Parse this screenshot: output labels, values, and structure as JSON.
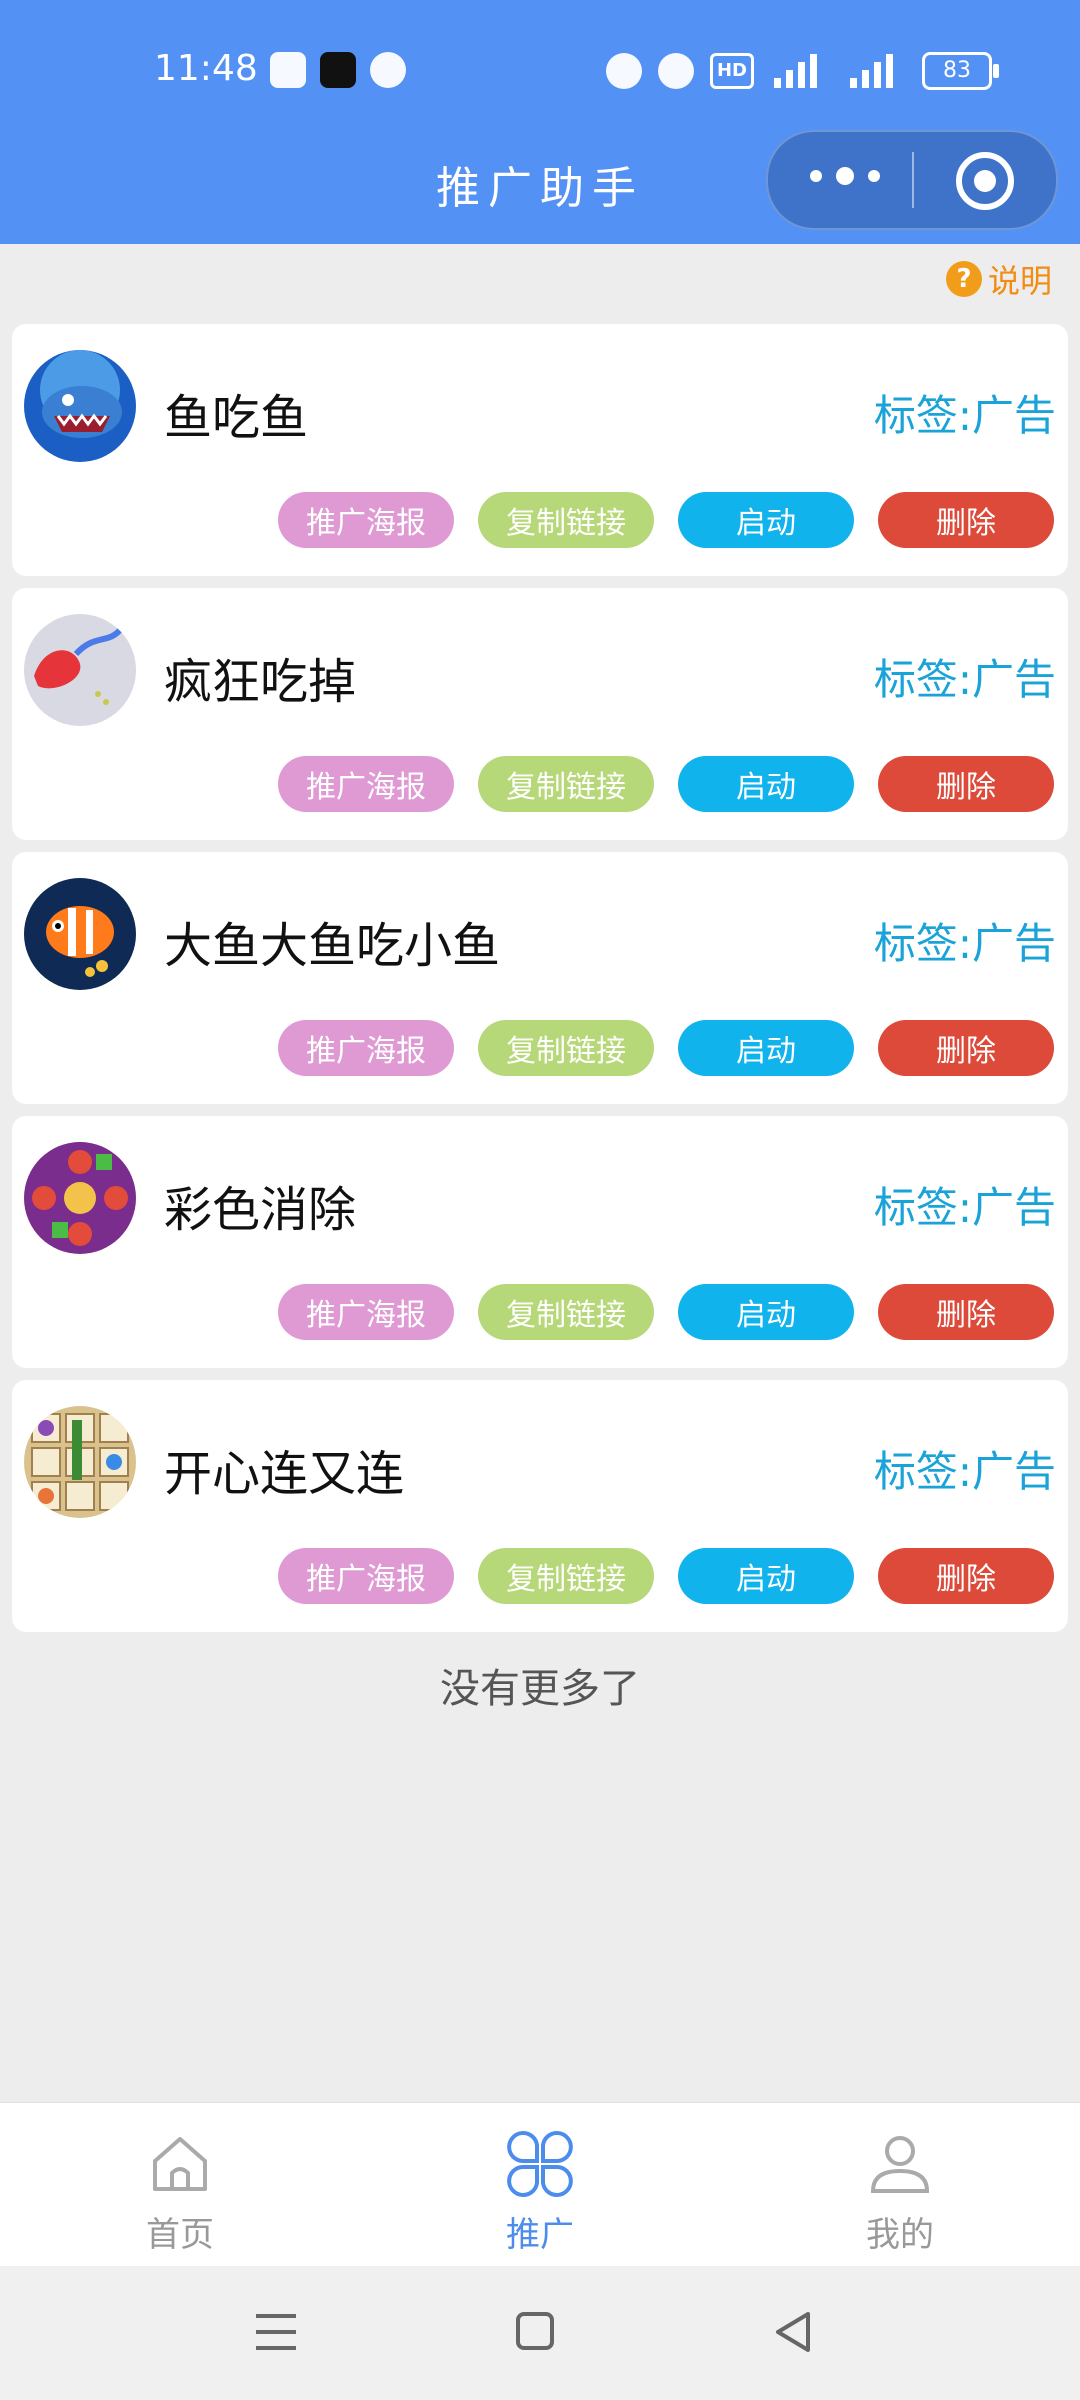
{
  "status_bar": {
    "time": "11:48",
    "hd_label": "HD",
    "battery": "83"
  },
  "header": {
    "title": "推广助手"
  },
  "help": {
    "icon": "?",
    "label": "说明"
  },
  "games": [
    {
      "name": "鱼吃鱼",
      "tag": "标签:广告",
      "avatar_colors": [
        "#1c5fc4",
        "#5fb5f5"
      ]
    },
    {
      "name": "疯狂吃掉",
      "tag": "标签:广告",
      "avatar_colors": [
        "#d9d9e3",
        "#e5343a"
      ]
    },
    {
      "name": "大鱼大鱼吃小鱼",
      "tag": "标签:广告",
      "avatar_colors": [
        "#0f2a55",
        "#ff7a1a"
      ]
    },
    {
      "name": "彩色消除",
      "tag": "标签:广告",
      "avatar_colors": [
        "#7a2d8c",
        "#e34b3a"
      ]
    },
    {
      "name": "开心连又连",
      "tag": "标签:广告",
      "avatar_colors": [
        "#d9c28c",
        "#3c8a34"
      ]
    }
  ],
  "actions": {
    "poster": "推广海报",
    "copy_link": "复制链接",
    "launch": "启动",
    "delete": "删除"
  },
  "list_end": "没有更多了",
  "tabbar": {
    "home": "首页",
    "promote": "推广",
    "mine": "我的"
  },
  "colors": {
    "primary": "#5491f5",
    "tag": "#1aa3d9",
    "poster_btn": "#df9ad4",
    "copy_btn": "#b7d878",
    "launch_btn": "#11b3ec",
    "delete_btn": "#dd4a3a",
    "help": "#f28c12"
  }
}
